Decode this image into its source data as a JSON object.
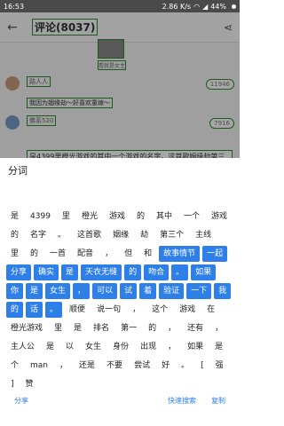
{
  "status_bar": {
    "time": "16:53",
    "speed": "2.86 K/s",
    "battery": "44%"
  },
  "bg": {
    "title": "评论(8037)",
    "thumb_caption": "看就是女主",
    "comment1_user": "路人人",
    "comment1_likes": "11946",
    "comment1_text": "我因为姻缘劫～好喜欢童嫁～",
    "comment2_user": "佛系520",
    "comment2_likes": "7916",
    "comment2_body": "是4399里橙光游戏的其中一个游戏的名字。这首歌姻缘劫第三个主线里的一首配音，但和故事情节一起分享确实是天衣无缝的吻合。如果你是女生，可以试着验证一下我的话。顺便说一句，这个游戏在橙光游戏里是排名第一的，还有，主人公是以女生身份出现，如果是个man，还是不要尝试好。【强】赞"
  },
  "sheet": {
    "title": "分词",
    "tokens": [
      {
        "t": "是",
        "s": false
      },
      {
        "t": "4399",
        "s": false
      },
      {
        "t": "里",
        "s": false
      },
      {
        "t": "橙光",
        "s": false
      },
      {
        "t": "游戏",
        "s": false
      },
      {
        "t": "的",
        "s": false
      },
      {
        "t": "其中",
        "s": false
      },
      {
        "t": "一个",
        "s": false
      },
      {
        "t": "游戏",
        "s": false
      },
      {
        "t": "的",
        "s": false
      },
      {
        "t": "名字",
        "s": false
      },
      {
        "t": "。",
        "s": false
      },
      {
        "t": "这首歌",
        "s": false
      },
      {
        "t": "姻缘",
        "s": false
      },
      {
        "t": "劫",
        "s": false
      },
      {
        "t": "第三个",
        "s": false
      },
      {
        "t": "主线",
        "s": false
      },
      {
        "t": "里",
        "s": false
      },
      {
        "t": "的",
        "s": false
      },
      {
        "t": "一首",
        "s": false
      },
      {
        "t": "配音",
        "s": false
      },
      {
        "t": "，",
        "s": false
      },
      {
        "t": "但",
        "s": false
      },
      {
        "t": "和",
        "s": false
      },
      {
        "t": "故事情节",
        "s": true
      },
      {
        "t": "一起",
        "s": true
      },
      {
        "t": "分享",
        "s": true
      },
      {
        "t": "确实",
        "s": true
      },
      {
        "t": "是",
        "s": true
      },
      {
        "t": "天衣无缝",
        "s": true
      },
      {
        "t": "的",
        "s": true
      },
      {
        "t": "吻合",
        "s": true
      },
      {
        "t": "。",
        "s": true
      },
      {
        "t": "如果",
        "s": true
      },
      {
        "t": "你",
        "s": true
      },
      {
        "t": "是",
        "s": true
      },
      {
        "t": "女生",
        "s": true
      },
      {
        "t": "，",
        "s": true
      },
      {
        "t": "可以",
        "s": true
      },
      {
        "t": "试",
        "s": true
      },
      {
        "t": "着",
        "s": true
      },
      {
        "t": "验证",
        "s": true
      },
      {
        "t": "一下",
        "s": true
      },
      {
        "t": "我",
        "s": true
      },
      {
        "t": "的",
        "s": true
      },
      {
        "t": "话",
        "s": true
      },
      {
        "t": "。",
        "s": true
      },
      {
        "t": "顺便",
        "s": false
      },
      {
        "t": "说一句",
        "s": false
      },
      {
        "t": "，",
        "s": false
      },
      {
        "t": "这个",
        "s": false
      },
      {
        "t": "游戏",
        "s": false
      },
      {
        "t": "在",
        "s": false
      },
      {
        "t": "橙光游戏",
        "s": false
      },
      {
        "t": "里",
        "s": false
      },
      {
        "t": "是",
        "s": false
      },
      {
        "t": "排名",
        "s": false
      },
      {
        "t": "第一",
        "s": false
      },
      {
        "t": "的",
        "s": false
      },
      {
        "t": "，",
        "s": false
      },
      {
        "t": "还有",
        "s": false
      },
      {
        "t": "，",
        "s": false
      },
      {
        "t": "主人公",
        "s": false
      },
      {
        "t": "是",
        "s": false
      },
      {
        "t": "以",
        "s": false
      },
      {
        "t": "女生",
        "s": false
      },
      {
        "t": "身份",
        "s": false
      },
      {
        "t": "出现",
        "s": false
      },
      {
        "t": "，",
        "s": false
      },
      {
        "t": "如果",
        "s": false
      },
      {
        "t": "是",
        "s": false
      },
      {
        "t": "个",
        "s": false
      },
      {
        "t": "man",
        "s": false
      },
      {
        "t": "，",
        "s": false
      },
      {
        "t": "还是",
        "s": false
      },
      {
        "t": "不要",
        "s": false
      },
      {
        "t": "尝试",
        "s": false
      },
      {
        "t": "好",
        "s": false
      },
      {
        "t": "。",
        "s": false
      },
      {
        "t": "[",
        "s": false
      },
      {
        "t": "强",
        "s": false
      },
      {
        "t": "]",
        "s": false
      },
      {
        "t": "赞",
        "s": false
      }
    ],
    "actions": {
      "share": "分享",
      "quick_search": "快速搜索",
      "copy": "复制"
    }
  },
  "colors": {
    "accent": "#2f7fe8",
    "box_outline": "#2e8b2e"
  }
}
